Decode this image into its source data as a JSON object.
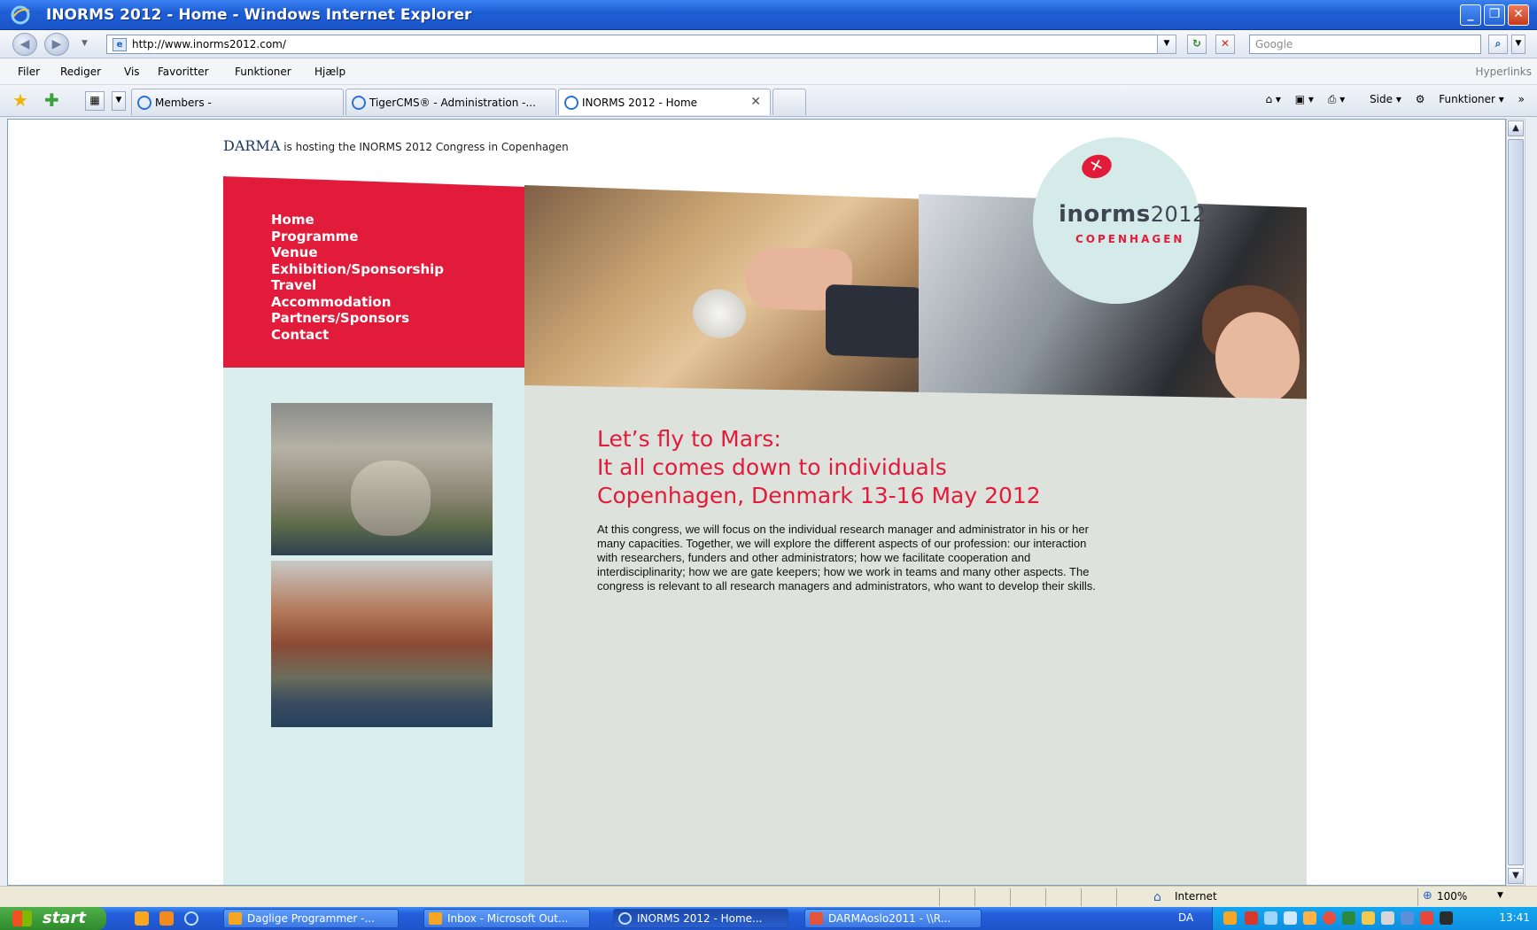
{
  "window": {
    "title": "INORMS 2012 - Home - Windows Internet Explorer",
    "min_label": "_",
    "restore_label": "❐",
    "close_label": "✕"
  },
  "address": {
    "url": "http://www.inorms2012.com/",
    "search_placeholder": "Google",
    "refresh_label": "↻",
    "stop_label": "✕",
    "search_go_label": "⌕"
  },
  "menu": {
    "items": [
      "Filer",
      "Rediger",
      "Vis",
      "Favoritter",
      "Funktioner",
      "Hjælp"
    ],
    "hyperlinks": "Hyperlinks"
  },
  "tabs": [
    {
      "label": "Members -",
      "active": false
    },
    {
      "label": "TigerCMS® - Administration -...",
      "active": false
    },
    {
      "label": "INORMS 2012 - Home",
      "active": true
    }
  ],
  "commands": {
    "page": "Side",
    "tools": "Funktioner"
  },
  "page": {
    "darma_brand": "DARMA",
    "darma_text": "is hosting the INORMS 2012 Congress in Copenhagen",
    "nav": [
      "Home",
      "Programme",
      "Venue",
      "Exhibition/Sponsorship",
      "Travel",
      "Accommodation",
      "Partners/Sponsors",
      "Contact"
    ],
    "logo_word": "inorms",
    "logo_year": "2012",
    "logo_city": "COPENHAGEN",
    "headline": [
      "Let’s fly to Mars:",
      "It all comes down to individuals",
      "Copenhagen, Denmark 13-16 May 2012"
    ],
    "body": "At this congress, we will focus on the individual research manager and administrator in his or her many capacities. Together, we will explore the different aspects of our profession: our interaction with researchers, funders and other administrators; how we facilitate cooperation and interdisciplinarity; how we are gate keepers; how we work in teams and many other aspects. The congress is relevant to all research managers and administrators, who want to develop their skills."
  },
  "status": {
    "zone": "Internet",
    "zoom": "100%"
  },
  "taskbar": {
    "start": "start",
    "tasks": [
      {
        "label": "Daglige Programmer -...",
        "active": false
      },
      {
        "label": "Inbox - Microsoft Out...",
        "active": false
      },
      {
        "label": "INORMS 2012 - Home...",
        "active": true
      },
      {
        "label": "DARMAoslo2011 - \\\\R...",
        "active": false
      }
    ],
    "lang": "DA",
    "clock": "13:41"
  },
  "colors": {
    "brand_red": "#e21b3a",
    "xp_blue": "#245edb"
  }
}
